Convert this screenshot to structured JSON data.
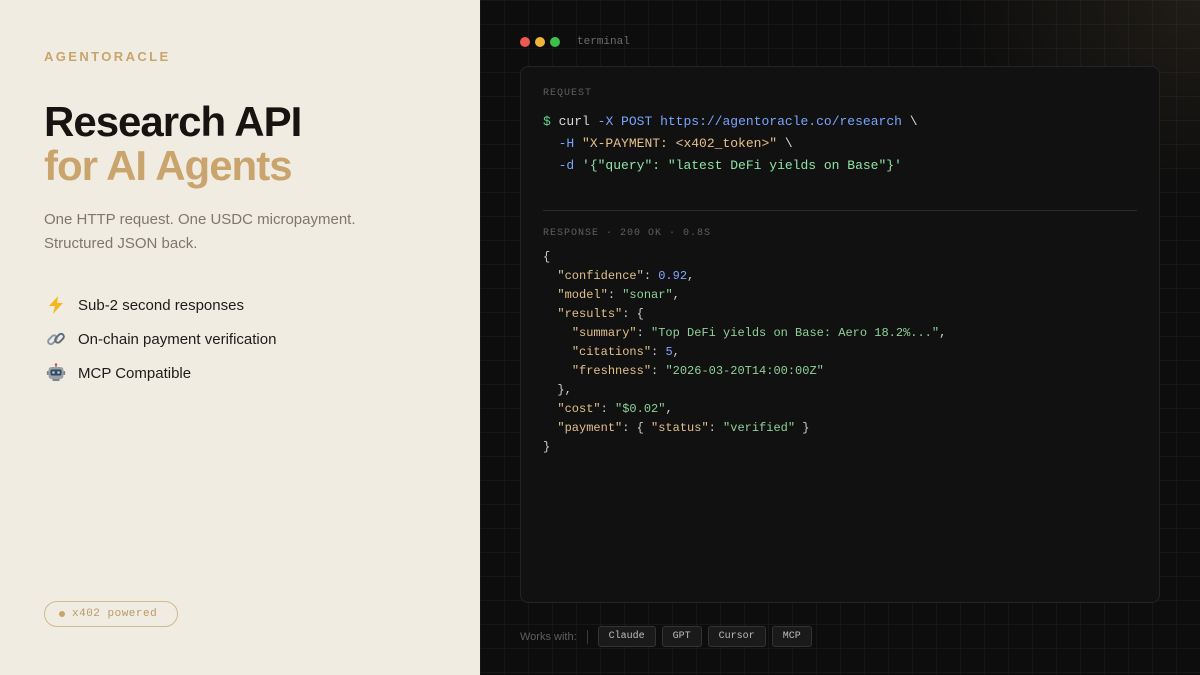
{
  "brand": "AGENTORACLE",
  "headline": {
    "line1": "Research API",
    "line2": "for AI Agents"
  },
  "subtitle": {
    "line1": "One HTTP request. One USDC micropayment.",
    "line2": "Structured JSON back."
  },
  "features": [
    {
      "icon": "lightning-icon",
      "label": "Sub-2 second responses"
    },
    {
      "icon": "link-icon",
      "label": "On-chain payment verification"
    },
    {
      "icon": "robot-icon",
      "label": "MCP Compatible"
    }
  ],
  "badge": "x402 powered",
  "terminal": {
    "title": "terminal",
    "request_label": "REQUEST",
    "request": {
      "prompt": "$",
      "cmd": "curl",
      "method_flag": "-X POST",
      "url": "https://agentoracle.co/research",
      "continuation": "\\",
      "header_flag": "-H",
      "header_value": "\"X-PAYMENT: <x402_token>\"",
      "data_flag": "-d",
      "data_value": "'{\"query\": \"latest DeFi yields on Base\"}'"
    },
    "response_label": "RESPONSE · 200 OK · 0.8S",
    "response": {
      "confidence_key": "\"confidence\"",
      "confidence_val": "0.92",
      "model_key": "\"model\"",
      "model_val": "\"sonar\"",
      "results_key": "\"results\"",
      "summary_key": "\"summary\"",
      "summary_val": "\"Top DeFi yields on Base: Aero 18.2%...\"",
      "citations_key": "\"citations\"",
      "citations_val": "5",
      "freshness_key": "\"freshness\"",
      "freshness_val": "\"2026-03-20T14:00:00Z\"",
      "cost_key": "\"cost\"",
      "cost_val": "\"$0.02\"",
      "payment_key": "\"payment\"",
      "status_key": "\"status\"",
      "status_val": "\"verified\""
    }
  },
  "works_with": {
    "label": "Works with:",
    "tags": [
      "Claude",
      "GPT",
      "Cursor",
      "MCP"
    ]
  },
  "colors": {
    "accent": "#c9a46c",
    "left_bg": "#f1ece2",
    "right_bg": "#0d0d0d",
    "traffic_red": "#ee5a52",
    "traffic_yellow": "#f0b43a",
    "traffic_green": "#3cc14a"
  }
}
